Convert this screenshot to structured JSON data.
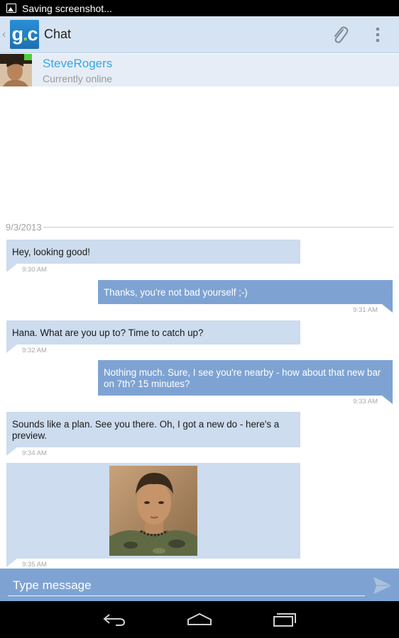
{
  "status_bar": {
    "notification": "Saving screenshot..."
  },
  "action_bar": {
    "logo_text_left": "g",
    "logo_text_dot": ".",
    "logo_text_right": "c",
    "title": "Chat"
  },
  "contact": {
    "name": "SteveRogers",
    "status": "Currently online"
  },
  "date_divider": "9/3/2013",
  "messages": [
    {
      "direction": "incoming",
      "text": "Hey, looking good!",
      "time": "9:30 AM"
    },
    {
      "direction": "outgoing",
      "text": "Thanks, you're not bad yourself ;-)",
      "time": "9:31 AM"
    },
    {
      "direction": "incoming",
      "text": "Hana. What are you up to?  Time to catch up?",
      "time": "9:32 AM"
    },
    {
      "direction": "outgoing",
      "text": "Nothing much.  Sure, I see you're nearby - how about that new bar on 7th?  15 minutes?",
      "time": "9:33 AM"
    },
    {
      "direction": "incoming",
      "text": "Sounds like a plan. See you there. Oh, I got a new do - here's a preview.",
      "time": "9:34 AM"
    },
    {
      "direction": "incoming",
      "text": "",
      "time": "9:35 AM",
      "attachment": "photo"
    }
  ],
  "composer": {
    "placeholder": "Type message"
  },
  "colors": {
    "incoming_bubble": "#cddcee",
    "outgoing_bubble": "#7ea3d3",
    "contact_name": "#3aa6e0",
    "action_bar": "#d6e3f2"
  }
}
